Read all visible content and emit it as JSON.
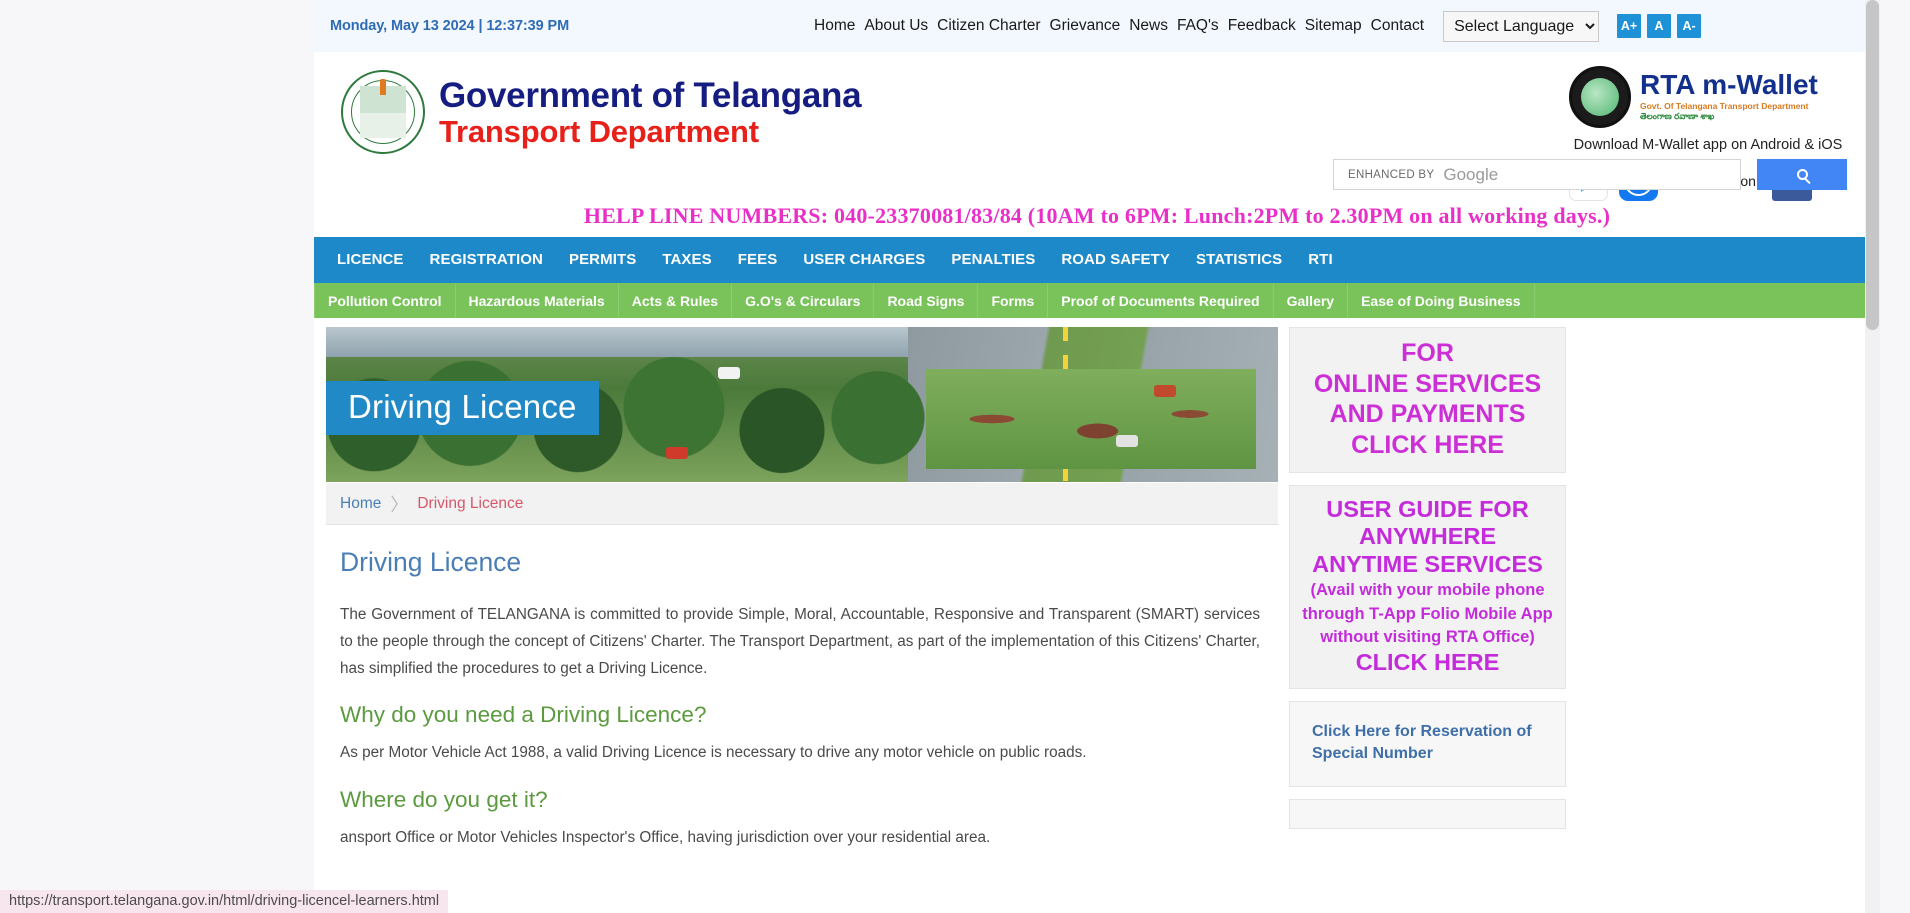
{
  "topbar": {
    "datetime": "Monday, May 13 2024 | 12:37:39 PM",
    "nav": [
      {
        "label": "Home"
      },
      {
        "label": "About Us"
      },
      {
        "label": "Citizen Charter"
      },
      {
        "label": "Grievance"
      },
      {
        "label": "News"
      },
      {
        "label": "FAQ's"
      },
      {
        "label": "Feedback"
      },
      {
        "label": "Sitemap"
      },
      {
        "label": "Contact"
      }
    ],
    "language_selected": "Select Language",
    "language_options": [
      "Select Language"
    ],
    "font_increase": "A+",
    "font_normal": "A",
    "font_decrease": "A-"
  },
  "header": {
    "brand_line1": "Government of Telangana",
    "brand_line2": "Transport Department",
    "mwallet_title": "RTA m-Wallet",
    "mwallet_sub1": "Govt. Of Telangana Transport Department",
    "mwallet_sub2": "తెలంగాణ రవాణా శాఖ",
    "mwallet_download": "Download M-Wallet app on Android & iOS",
    "follow_text": "Follow Us on",
    "search_enhanced": "ENHANCED BY",
    "search_google": "Google",
    "search_placeholder": "",
    "search_value": "",
    "helpline": "HELP LINE NUMBERS: 040-23370081/83/84 (10AM to 6PM: Lunch:2PM to 2.30PM on all working days.)"
  },
  "mainnav": [
    {
      "label": "LICENCE"
    },
    {
      "label": "REGISTRATION"
    },
    {
      "label": "PERMITS"
    },
    {
      "label": "TAXES"
    },
    {
      "label": "FEES"
    },
    {
      "label": "USER CHARGES"
    },
    {
      "label": "PENALTIES"
    },
    {
      "label": "ROAD SAFETY"
    },
    {
      "label": "STATISTICS"
    },
    {
      "label": "RTI"
    }
  ],
  "subnav": [
    {
      "label": "Pollution Control"
    },
    {
      "label": "Hazardous Materials"
    },
    {
      "label": "Acts & Rules"
    },
    {
      "label": "G.O's & Circulars"
    },
    {
      "label": "Road Signs"
    },
    {
      "label": "Forms"
    },
    {
      "label": "Proof of Documents Required"
    },
    {
      "label": "Gallery"
    },
    {
      "label": "Ease of Doing Business"
    }
  ],
  "hero": {
    "title": "Driving Licence"
  },
  "breadcrumb": {
    "home": "Home",
    "separator": "〉",
    "current": "Driving Licence"
  },
  "article": {
    "title": "Driving Licence",
    "intro": "The Government of TELANGANA is committed to provide Simple, Moral, Accountable, Responsive and Transparent (SMART) services to the people through the concept of Citizens' Charter. The Transport Department, as part of the implementation of this Citizens' Charter, has simplified the procedures to get a Driving Licence.",
    "h2_why": "Why do you need a Driving Licence?",
    "p_why": "As per Motor Vehicle Act 1988, a valid Driving Licence is necessary to drive any motor vehicle on public roads.",
    "h2_where": "Where do you get it?",
    "p_where": "ansport Office or Motor Vehicles Inspector's Office, having jurisdiction over your residential area."
  },
  "sidebar": {
    "banner1": [
      "FOR",
      "ONLINE SERVICES",
      "AND PAYMENTS",
      "CLICK HERE"
    ],
    "banner2_big": [
      "USER GUIDE FOR",
      "ANYWHERE",
      "ANYTIME SERVICES"
    ],
    "banner2_small": [
      "(Avail with your mobile phone",
      "through T-App Folio Mobile App",
      "without visiting RTA Office)"
    ],
    "banner2_cta": "CLICK HERE",
    "banner3_link": "Click Here for Reservation of Special Number"
  },
  "statusbar": {
    "url": "https://transport.telangana.gov.in/html/driving-licencel-learners.html"
  },
  "colors": {
    "topbar_bg": "#f2f8fd",
    "date_text": "#2f6cb5",
    "accent_blue": "#1d89c9",
    "nav_green": "#79c35a",
    "brand_navy": "#151d80",
    "brand_red": "#e8201a",
    "helpline_pink": "#e830c8",
    "banner_magenta": "#cd2fd6",
    "heading_blue": "#4a7fb5",
    "heading_green": "#5c9a3f",
    "crumb_current": "#d6576b",
    "google_blue": "#4285f4"
  }
}
